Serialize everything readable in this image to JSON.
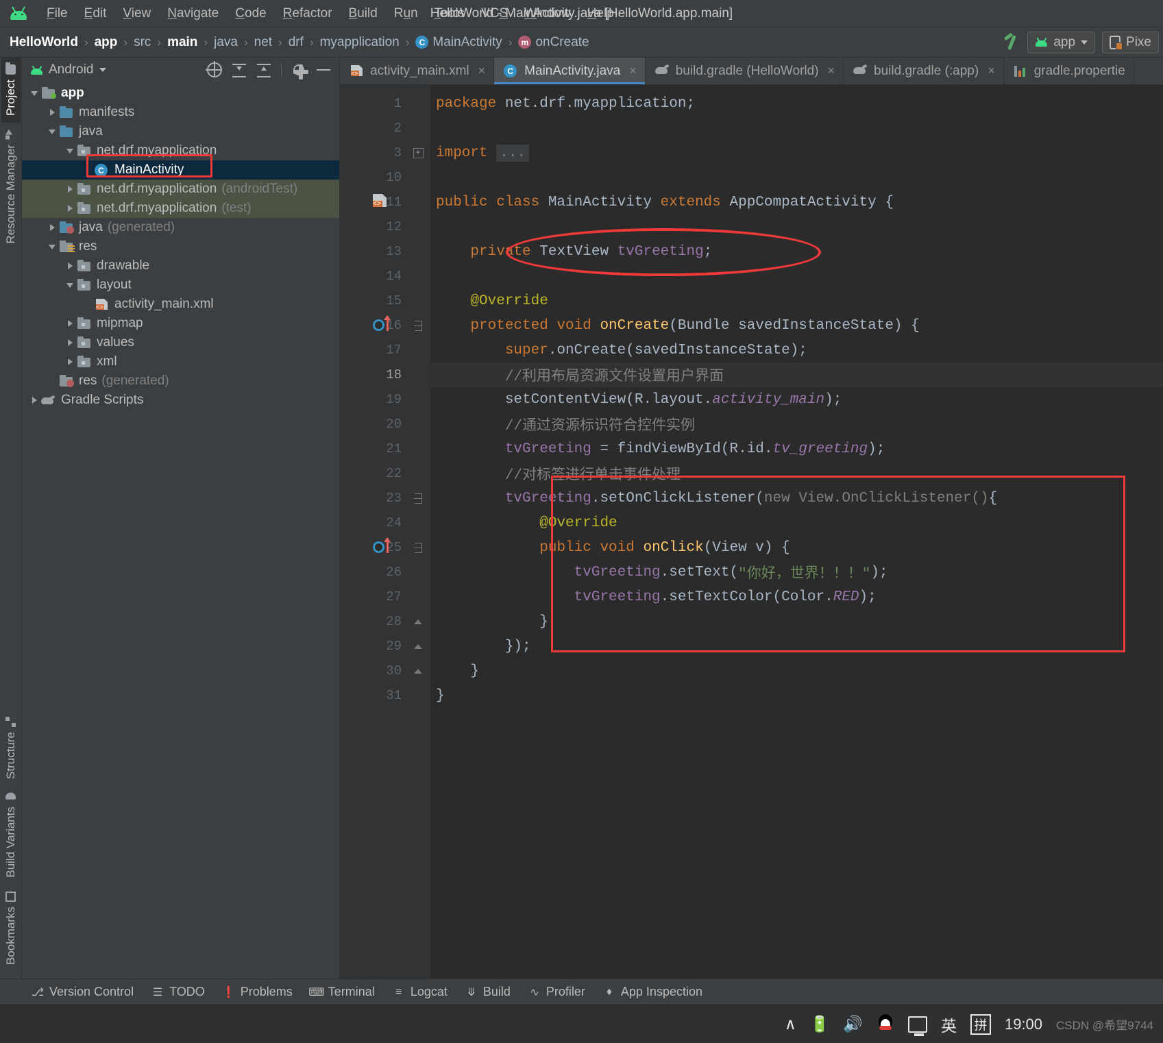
{
  "window": {
    "title": "HelloWorld - MainActivity.java [HelloWorld.app.main]"
  },
  "menubar": {
    "items": [
      {
        "label": "File",
        "mnemonic": "F"
      },
      {
        "label": "Edit",
        "mnemonic": "E"
      },
      {
        "label": "View",
        "mnemonic": "V"
      },
      {
        "label": "Navigate",
        "mnemonic": "N"
      },
      {
        "label": "Code",
        "mnemonic": "C"
      },
      {
        "label": "Refactor",
        "mnemonic": "R"
      },
      {
        "label": "Build",
        "mnemonic": "B"
      },
      {
        "label": "Run",
        "mnemonic": "u"
      },
      {
        "label": "Tools",
        "mnemonic": "T"
      },
      {
        "label": "VCS",
        "mnemonic": "S"
      },
      {
        "label": "Window",
        "mnemonic": "W"
      },
      {
        "label": "Help",
        "mnemonic": "H"
      }
    ]
  },
  "breadcrumb": {
    "items": [
      {
        "label": "HelloWorld",
        "bold": true,
        "icon": ""
      },
      {
        "label": "app",
        "bold": true,
        "icon": ""
      },
      {
        "label": "src",
        "bold": false,
        "icon": ""
      },
      {
        "label": "main",
        "bold": true,
        "icon": ""
      },
      {
        "label": "java",
        "bold": false,
        "icon": ""
      },
      {
        "label": "net",
        "bold": false,
        "icon": ""
      },
      {
        "label": "drf",
        "bold": false,
        "icon": ""
      },
      {
        "label": "myapplication",
        "bold": false,
        "icon": ""
      },
      {
        "label": "MainActivity",
        "bold": false,
        "icon": "class-icon"
      },
      {
        "label": "onCreate",
        "bold": false,
        "icon": "method-icon"
      }
    ],
    "separator": "›"
  },
  "toolbar_right": {
    "build_icon": "hammer-icon",
    "run_config": "app",
    "device": "Pixe"
  },
  "rail": {
    "top": [
      {
        "label": "Project",
        "icon": "folder-icon",
        "active": true
      },
      {
        "label": "Resource Manager",
        "icon": "shapes-icon",
        "active": false
      }
    ],
    "bottom": [
      {
        "label": "Structure",
        "icon": "grid-icon",
        "active": false
      },
      {
        "label": "Build Variants",
        "icon": "droid-icon",
        "active": false
      },
      {
        "label": "Bookmarks",
        "icon": "bookmark-icon",
        "active": false
      }
    ]
  },
  "project_panel": {
    "title": "Android",
    "tools": [
      {
        "name": "select-opened-file-icon"
      },
      {
        "name": "expand-all-icon"
      },
      {
        "name": "collapse-all-icon"
      },
      {
        "name": "settings-gear-icon"
      },
      {
        "name": "minimize-icon"
      }
    ],
    "tree": [
      {
        "label": "app",
        "dim": "",
        "indent": 0,
        "twist": "open",
        "icon": "module-folder",
        "bold": true,
        "state": "normal"
      },
      {
        "label": "manifests",
        "dim": "",
        "indent": 1,
        "twist": "closed",
        "icon": "blue-folder",
        "bold": false,
        "state": "normal"
      },
      {
        "label": "java",
        "dim": "",
        "indent": 1,
        "twist": "open",
        "icon": "blue-folder",
        "bold": false,
        "state": "normal"
      },
      {
        "label": "net.drf.myapplication",
        "dim": "",
        "indent": 2,
        "twist": "open",
        "icon": "package-folder",
        "bold": false,
        "state": "normal"
      },
      {
        "label": "MainActivity",
        "dim": "",
        "indent": 3,
        "twist": "none",
        "icon": "class-icon",
        "bold": false,
        "state": "selected"
      },
      {
        "label": "net.drf.myapplication",
        "dim": "(androidTest)",
        "indent": 2,
        "twist": "closed",
        "icon": "package-folder",
        "bold": false,
        "state": "testsrc"
      },
      {
        "label": "net.drf.myapplication",
        "dim": "(test)",
        "indent": 2,
        "twist": "closed",
        "icon": "package-folder",
        "bold": false,
        "state": "testsrc"
      },
      {
        "label": "java",
        "dim": "(generated)",
        "indent": 1,
        "twist": "closed",
        "icon": "generated-folder",
        "bold": false,
        "state": "normal"
      },
      {
        "label": "res",
        "dim": "",
        "indent": 1,
        "twist": "open",
        "icon": "res-folder",
        "bold": false,
        "state": "normal"
      },
      {
        "label": "drawable",
        "dim": "",
        "indent": 2,
        "twist": "closed",
        "icon": "package-folder",
        "bold": false,
        "state": "normal"
      },
      {
        "label": "layout",
        "dim": "",
        "indent": 2,
        "twist": "open",
        "icon": "package-folder",
        "bold": false,
        "state": "normal"
      },
      {
        "label": "activity_main.xml",
        "dim": "",
        "indent": 3,
        "twist": "none",
        "icon": "xml-icon",
        "bold": false,
        "state": "normal"
      },
      {
        "label": "mipmap",
        "dim": "",
        "indent": 2,
        "twist": "closed",
        "icon": "package-folder",
        "bold": false,
        "state": "normal"
      },
      {
        "label": "values",
        "dim": "",
        "indent": 2,
        "twist": "closed",
        "icon": "package-folder",
        "bold": false,
        "state": "normal"
      },
      {
        "label": "xml",
        "dim": "",
        "indent": 2,
        "twist": "closed",
        "icon": "package-folder",
        "bold": false,
        "state": "normal"
      },
      {
        "label": "res",
        "dim": "(generated)",
        "indent": 1,
        "twist": "none",
        "icon": "generated-folder",
        "bold": false,
        "state": "normal"
      },
      {
        "label": "Gradle Scripts",
        "dim": "",
        "indent": 0,
        "twist": "closed",
        "icon": "gradle-icon",
        "bold": false,
        "state": "normal"
      }
    ]
  },
  "editor": {
    "tabs": [
      {
        "label": "activity_main.xml",
        "icon": "xml-icon",
        "active": false,
        "close": "×"
      },
      {
        "label": "MainActivity.java",
        "icon": "class-icon",
        "active": true,
        "close": "×"
      },
      {
        "label": "build.gradle (HelloWorld)",
        "icon": "gradle-icon",
        "active": false,
        "close": "×"
      },
      {
        "label": "build.gradle (:app)",
        "icon": "gradle-icon",
        "active": false,
        "close": "×"
      },
      {
        "label": "gradle.propertie",
        "icon": "properties-icon",
        "active": false,
        "close": ""
      }
    ],
    "current_line": 18,
    "lines": [
      {
        "num": "1",
        "gutter": "",
        "fold": "",
        "tokens": [
          [
            "kw",
            "package "
          ],
          [
            "plain",
            "net.drf.myapplication;"
          ]
        ]
      },
      {
        "num": "2",
        "gutter": "",
        "fold": "",
        "tokens": []
      },
      {
        "num": "3",
        "gutter": "",
        "fold": "plus",
        "tokens": [
          [
            "kw",
            "import "
          ],
          [
            "gray",
            "..."
          ]
        ]
      },
      {
        "num": "10",
        "gutter": "",
        "fold": "",
        "tokens": []
      },
      {
        "num": "11",
        "gutter": "xml-marker",
        "fold": "",
        "tokens": [
          [
            "kw",
            "public class "
          ],
          [
            "plain",
            "MainActivity "
          ],
          [
            "kw",
            "extends "
          ],
          [
            "plain",
            "AppCompatActivity {"
          ]
        ]
      },
      {
        "num": "12",
        "gutter": "",
        "fold": "",
        "tokens": []
      },
      {
        "num": "13",
        "gutter": "",
        "fold": "",
        "tokens": [
          [
            "plain",
            "    "
          ],
          [
            "kw",
            "private "
          ],
          [
            "plain",
            "TextView "
          ],
          [
            "fld2",
            "tvGreeting"
          ],
          [
            "plain",
            ";"
          ]
        ]
      },
      {
        "num": "14",
        "gutter": "",
        "fold": "",
        "tokens": []
      },
      {
        "num": "15",
        "gutter": "",
        "fold": "",
        "tokens": [
          [
            "plain",
            "    "
          ],
          [
            "ann",
            "@Override"
          ]
        ]
      },
      {
        "num": "16",
        "gutter": "override-marker",
        "fold": "minus",
        "tokens": [
          [
            "plain",
            "    "
          ],
          [
            "kw",
            "protected void "
          ],
          [
            "mthd",
            "onCreate"
          ],
          [
            "plain",
            "(Bundle savedInstanceState) {"
          ]
        ]
      },
      {
        "num": "17",
        "gutter": "",
        "fold": "",
        "tokens": [
          [
            "plain",
            "        "
          ],
          [
            "kw",
            "super"
          ],
          [
            "plain",
            ".onCreate(savedInstanceState);"
          ]
        ]
      },
      {
        "num": "18",
        "gutter": "",
        "fold": "",
        "tokens": [
          [
            "plain",
            "        "
          ],
          [
            "cmt",
            "//利用布局资源文件设置用户界面"
          ]
        ]
      },
      {
        "num": "19",
        "gutter": "",
        "fold": "",
        "tokens": [
          [
            "plain",
            "        setContentView(R.layout."
          ],
          [
            "stat",
            "activity_main"
          ],
          [
            "plain",
            ");"
          ]
        ]
      },
      {
        "num": "20",
        "gutter": "",
        "fold": "",
        "tokens": [
          [
            "plain",
            "        "
          ],
          [
            "cmt",
            "//通过资源标识符合控件实例"
          ]
        ]
      },
      {
        "num": "21",
        "gutter": "",
        "fold": "",
        "tokens": [
          [
            "plain",
            "        "
          ],
          [
            "fld2",
            "tvGreeting"
          ],
          [
            "plain",
            " = findViewById(R.id."
          ],
          [
            "stat",
            "tv_greeting"
          ],
          [
            "plain",
            ");"
          ]
        ]
      },
      {
        "num": "22",
        "gutter": "",
        "fold": "",
        "tokens": [
          [
            "plain",
            "        "
          ],
          [
            "cmt",
            "//对标签进行单击事件处理"
          ]
        ]
      },
      {
        "num": "23",
        "gutter": "",
        "fold": "minus",
        "tokens": [
          [
            "plain",
            "        "
          ],
          [
            "fld2",
            "tvGreeting"
          ],
          [
            "plain",
            ".setOnClickListener("
          ],
          [
            "gray",
            "new View.OnClickListener()"
          ],
          [
            "plain",
            "{"
          ]
        ]
      },
      {
        "num": "24",
        "gutter": "",
        "fold": "",
        "tokens": [
          [
            "plain",
            "            "
          ],
          [
            "ann",
            "@Override"
          ]
        ]
      },
      {
        "num": "25",
        "gutter": "override-marker",
        "fold": "minus",
        "tokens": [
          [
            "plain",
            "            "
          ],
          [
            "kw",
            "public void "
          ],
          [
            "mthd",
            "onClick"
          ],
          [
            "plain",
            "(View v) {"
          ]
        ]
      },
      {
        "num": "26",
        "gutter": "",
        "fold": "",
        "tokens": [
          [
            "plain",
            "                "
          ],
          [
            "fld2",
            "tvGreeting"
          ],
          [
            "plain",
            ".setText("
          ],
          [
            "str",
            "\"你好，世界！！！\""
          ],
          [
            "plain",
            ");"
          ]
        ]
      },
      {
        "num": "27",
        "gutter": "",
        "fold": "",
        "tokens": [
          [
            "plain",
            "                "
          ],
          [
            "fld2",
            "tvGreeting"
          ],
          [
            "plain",
            ".setTextColor(Color."
          ],
          [
            "stat",
            "RED"
          ],
          [
            "plain",
            ");"
          ]
        ]
      },
      {
        "num": "28",
        "gutter": "",
        "fold": "up",
        "tokens": [
          [
            "plain",
            "            }"
          ]
        ]
      },
      {
        "num": "29",
        "gutter": "",
        "fold": "up",
        "tokens": [
          [
            "plain",
            "        });"
          ]
        ]
      },
      {
        "num": "30",
        "gutter": "",
        "fold": "up",
        "tokens": [
          [
            "plain",
            "    }"
          ]
        ]
      },
      {
        "num": "31",
        "gutter": "",
        "fold": "",
        "tokens": [
          [
            "plain",
            "}"
          ]
        ]
      }
    ]
  },
  "status_bar": {
    "items": [
      {
        "label": "Version Control",
        "icon": "branch-icon"
      },
      {
        "label": "TODO",
        "icon": "list-icon"
      },
      {
        "label": "Problems",
        "icon": "exclamation-icon"
      },
      {
        "label": "Terminal",
        "icon": "terminal-icon"
      },
      {
        "label": "Logcat",
        "icon": "logcat-icon"
      },
      {
        "label": "Build",
        "icon": "hammer-icon"
      },
      {
        "label": "Profiler",
        "icon": "profiler-icon"
      },
      {
        "label": "App Inspection",
        "icon": "inspection-icon"
      }
    ]
  },
  "taskbar": {
    "tray": [
      {
        "name": "show-hidden-icons-chevron",
        "glyph": "∧"
      },
      {
        "name": "battery-icon",
        "glyph": ""
      },
      {
        "name": "volume-icon",
        "glyph": "🔊"
      },
      {
        "name": "qq-icon",
        "glyph": ""
      },
      {
        "name": "network-icon",
        "glyph": ""
      },
      {
        "name": "ime-language-icon",
        "glyph": "英"
      },
      {
        "name": "pinyin-mode-icon",
        "glyph": "拼"
      }
    ],
    "clock": "19:00",
    "watermark": "CSDN @希望9744"
  }
}
